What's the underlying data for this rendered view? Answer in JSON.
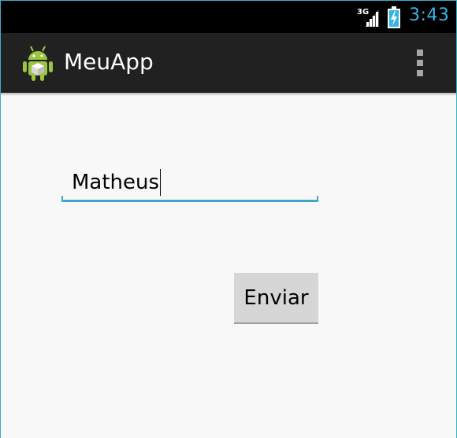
{
  "status_bar": {
    "network_type": "3G",
    "time": "3:43",
    "signal_icon": "signal-icon",
    "battery_icon": "battery-charging-icon",
    "clock_color": "#33b5e5"
  },
  "action_bar": {
    "app_icon": "android-robot-icon",
    "title": "MeuApp",
    "overflow_icon": "overflow-menu-icon",
    "background": "#212121"
  },
  "form": {
    "name_value": "Matheus",
    "accent_color": "#3fa6c8",
    "send_label": "Enviar"
  }
}
